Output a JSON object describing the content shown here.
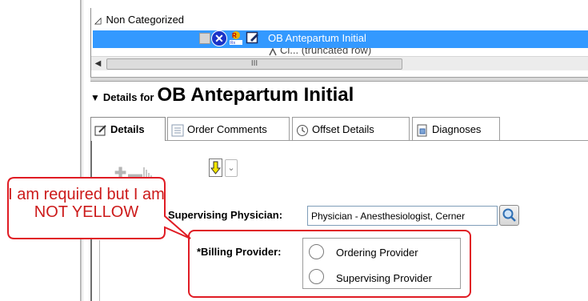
{
  "list": {
    "group_label": "Non Categorized",
    "group_toggle_icon": "triangle-down",
    "selected_item": "OB Antepartum Initial",
    "next_item_partial": "Cl... (truncated row)",
    "scroll_thumb_grip": "III"
  },
  "details": {
    "prefix": "Details for",
    "title": "OB Antepartum Initial"
  },
  "tabs": [
    {
      "label": "Details"
    },
    {
      "label": "Order Comments"
    },
    {
      "label": "Offset Details"
    },
    {
      "label": "Diagnoses"
    }
  ],
  "form": {
    "supervising_label": "Supervising Physician:",
    "supervising_value": "Physician - Anesthesiologist, Cerner",
    "billing_label": "*Billing Provider:",
    "billing_options": [
      "Ordering Provider",
      "Supervising Provider"
    ]
  },
  "annotation": {
    "text": "I am required but I am NOT YELLOW",
    "color": "#e01c24"
  },
  "colors": {
    "selection": "#3399ff",
    "accent_blue": "#1a34c8"
  }
}
